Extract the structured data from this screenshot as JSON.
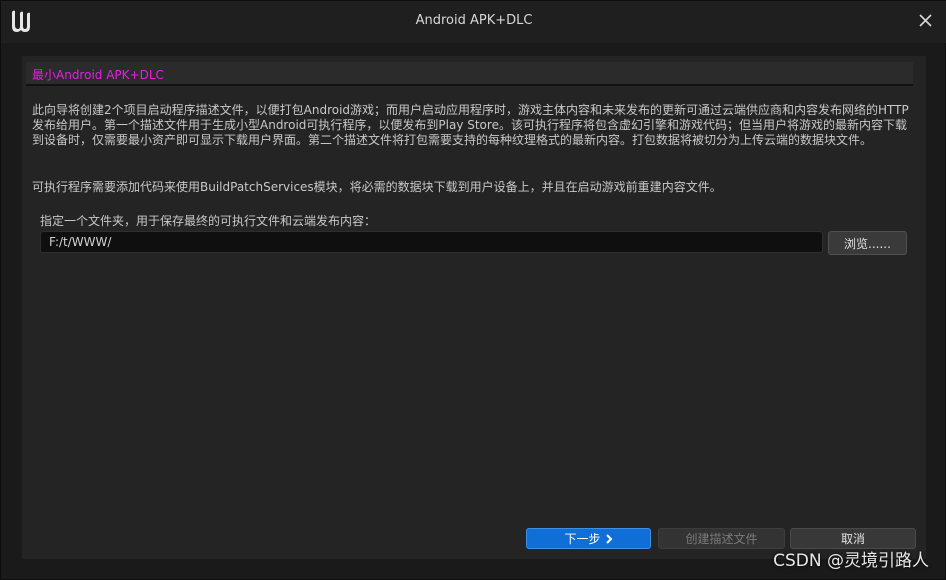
{
  "window": {
    "title": "Android APK+DLC",
    "logo_icon": "unreal-engine-logo-icon",
    "close_icon": "close-icon"
  },
  "page": {
    "title": "最小Android APK+DLC",
    "title_color": "#e81ee8",
    "description_1": "此向导将创建2个项目启动程序描述文件，以便打包Android游戏；而用户启动应用程序时，游戏主体内容和未来发布的更新可通过云端供应商和内容发布网络的HTTP发布给用户。第一个描述文件用于生成小型Android可执行程序，以便发布到Play Store。该可执行程序将包含虚幻引擎和游戏代码；但当用户将游戏的最新内容下载到设备时，仅需要最小资产即可显示下载用户界面。第二个描述文件将打包需要支持的每种纹理格式的最新内容。打包数据将被切分为上传云端的数据块文件。",
    "description_2": "可执行程序需要添加代码来使用BuildPatchServices模块，将必需的数据块下载到用户设备上，并且在启动游戏前重建内容文件。",
    "folder_label": "指定一个文件夹，用于保存最终的可执行文件和云端发布内容：",
    "folder_value": "F:/t/WWW/",
    "browse_label": "浏览......"
  },
  "buttons": {
    "next_label": "下一步",
    "next_icon": "chevron-right-icon",
    "create_label": "创建描述文件",
    "cancel_label": "取消",
    "accent_color": "#0f6fd6"
  },
  "watermark": {
    "text": "CSDN @灵境引路人"
  }
}
